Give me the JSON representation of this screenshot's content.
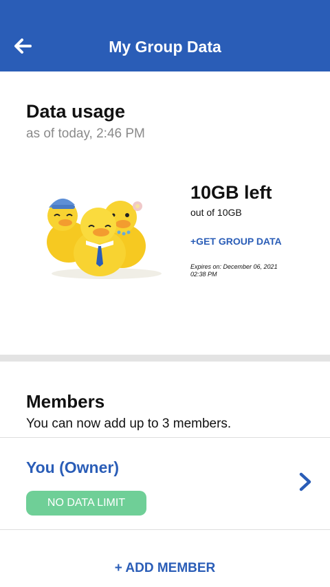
{
  "header": {
    "title": "My Group Data",
    "back_icon": "arrow-left-icon",
    "color": "#2a5db7"
  },
  "usage": {
    "title": "Data usage",
    "subtitle": "as of today, 2:46 PM",
    "illustration": "ducks-illustration",
    "left": "10GB left",
    "out_of": "out of 10GB",
    "get_data": "+GET GROUP DATA",
    "expires": "Expires on: December 06, 2021 02:38 PM"
  },
  "members": {
    "title": "Members",
    "subtitle": "You can now add up to 3 members.",
    "owner": {
      "name": "You (Owner)",
      "badge": "NO DATA LIMIT",
      "badge_color": "#6fcf97",
      "chevron_icon": "chevron-right-icon"
    },
    "add_member": "+ ADD MEMBER"
  }
}
